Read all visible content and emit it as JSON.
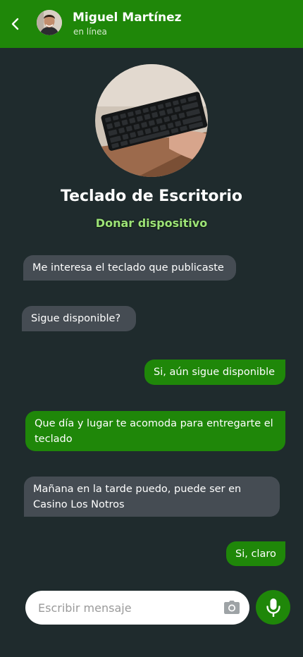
{
  "header": {
    "contact_name": "Miguel Martínez",
    "contact_status": "en línea",
    "accent_color": "#1f8709"
  },
  "product": {
    "title": "Teclado de Escritorio",
    "donate_label": "Donar dispositivo"
  },
  "messages": [
    {
      "direction": "incoming",
      "text": "Me interesa el teclado que publicaste"
    },
    {
      "direction": "incoming",
      "text": "Sigue disponible?"
    },
    {
      "direction": "outgoing",
      "text": "Si, aún sigue disponible"
    },
    {
      "direction": "outgoing",
      "text": "Que día y lugar te acomoda para entregarte el teclado"
    },
    {
      "direction": "incoming",
      "text": "Mañana en la tarde puedo, puede ser en Casino Los Notros"
    },
    {
      "direction": "outgoing",
      "text": "Si, claro"
    }
  ],
  "composer": {
    "placeholder": "Escribir mensaje",
    "value": ""
  },
  "icons": {
    "back": "chevron-left-icon",
    "camera": "camera-icon",
    "mic": "microphone-icon"
  },
  "colors": {
    "background": "#1f2b2d",
    "incoming_bubble": "#454c53",
    "outgoing_bubble": "#1f8709",
    "donate_link": "#9de277"
  }
}
